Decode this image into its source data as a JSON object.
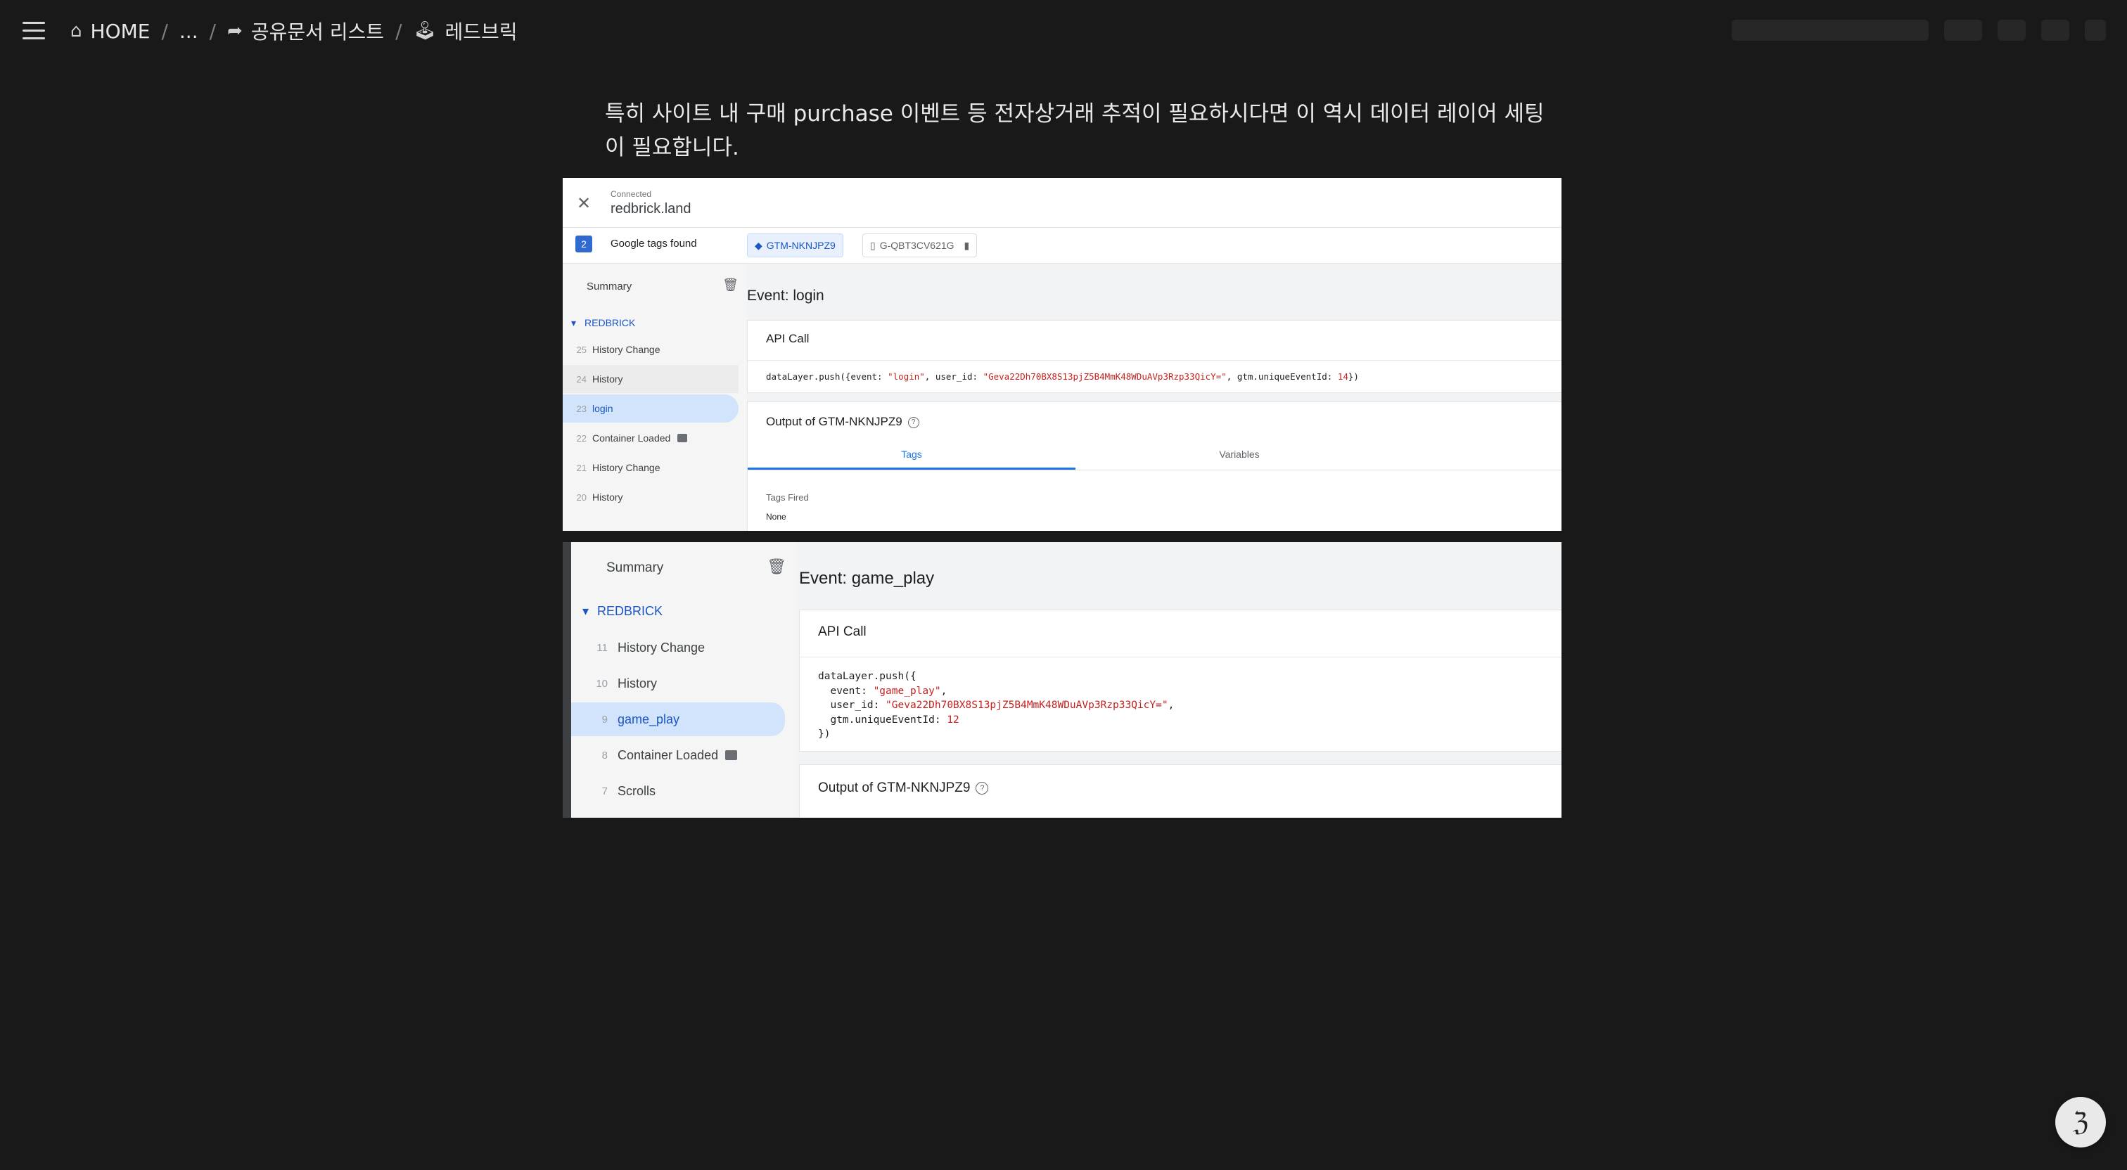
{
  "breadcrumb": {
    "home": "HOME",
    "ellipsis": "...",
    "shared": "공유문서 리스트",
    "current": "레드브릭"
  },
  "content": {
    "paragraph": "특히 사이트 내 구매 purchase 이벤트 등 전자상거래 추적이 필요하시다면 이 역시 데이터 레이어 세팅이 필요합니다."
  },
  "screenshot1": {
    "connected_label": "Connected",
    "domain": "redbrick.land",
    "tags_count": "2",
    "tags_found_label": "Google tags found",
    "chip_gtm": "GTM-NKNJPZ9",
    "chip_ga": "G-QBT3CV621G",
    "summary": "Summary",
    "group": "REDBRICK",
    "events": [
      {
        "num": "25",
        "label": "History Change"
      },
      {
        "num": "24",
        "label": "History"
      },
      {
        "num": "23",
        "label": "login"
      },
      {
        "num": "22",
        "label": "Container Loaded"
      },
      {
        "num": "21",
        "label": "History Change"
      },
      {
        "num": "20",
        "label": "History"
      }
    ],
    "event_title": "Event: login",
    "api_call_title": "API Call",
    "code_prefix": "dataLayer.push({event: ",
    "code_event": "\"login\"",
    "code_mid": ", user_id: ",
    "code_user": "\"Geva22Dh70BX8S13pjZ5B4MmK48WDuAVp3Rzp33QicY=\"",
    "code_mid2": ", gtm.uniqueEventId: ",
    "code_id": "14",
    "code_suffix": "})",
    "output_title": "Output of GTM-NKNJPZ9",
    "tab_tags": "Tags",
    "tab_variables": "Variables",
    "tags_fired_label": "Tags Fired",
    "tags_fired_value": "None"
  },
  "screenshot2": {
    "summary": "Summary",
    "group": "REDBRICK",
    "events": [
      {
        "num": "11",
        "label": "History Change"
      },
      {
        "num": "10",
        "label": "History"
      },
      {
        "num": "9",
        "label": "game_play"
      },
      {
        "num": "8",
        "label": "Container Loaded"
      },
      {
        "num": "7",
        "label": "Scrolls"
      }
    ],
    "event_title": "Event: game_play",
    "api_call_title": "API Call",
    "code_line1": "dataLayer.push({",
    "code_event_key": "  event: ",
    "code_event_val": "\"game_play\"",
    "code_user_key": "  user_id: ",
    "code_user_val": "\"Geva22Dh70BX8S13pjZ5B4MmK48WDuAVp3Rzp33QicY=\"",
    "code_id_key": "  gtm.uniqueEventId: ",
    "code_id_val": "12",
    "code_close": "})",
    "output_title": "Output of GTM-NKNJPZ9"
  }
}
